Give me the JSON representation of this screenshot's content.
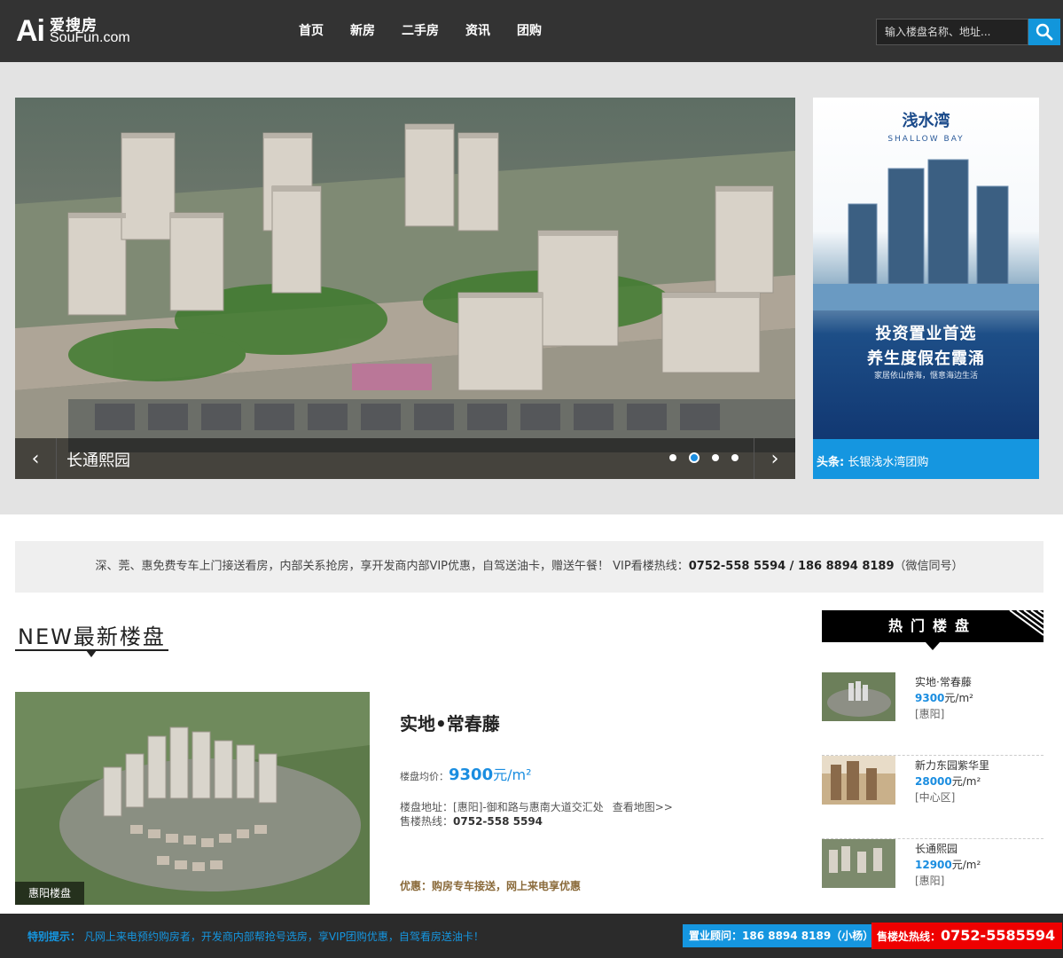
{
  "header": {
    "logo_ai": "Ai",
    "logo_cn": "爱搜房",
    "logo_en": "SouFun.com",
    "nav": [
      "首页",
      "新房",
      "二手房",
      "资讯",
      "团购"
    ],
    "search_placeholder": "输入楼盘名称、地址..."
  },
  "slider": {
    "caption": "长通熙园",
    "prev": "‹",
    "next": "›",
    "dots": 4,
    "active_dot": 2
  },
  "ad": {
    "brand": "浅水湾",
    "sub": "SHALLOW BAY",
    "slogan1": "投资置业首选",
    "slogan2": "养生度假在霞涌",
    "slogan3": "家居依山傍海，惬意海边生活",
    "headline_label": "头条:",
    "headline_text": "长银浅水湾团购"
  },
  "notice": {
    "text": "深、莞、惠免费专车上门接送看房，内部关系抢房，享开发商内部VIP优惠，自驾送油卡，赠送午餐！ VIP看楼热线：",
    "hotline": "0752-558 5594 / 186 8894 8189",
    "suffix": "（微信同号）"
  },
  "new_section": {
    "title": "NEW最新楼盘",
    "estate": {
      "tag": "惠阳楼盘",
      "name": "实地•常春藤",
      "price_label": "楼盘均价：",
      "price": "9300",
      "price_unit": "元/m²",
      "addr_label": "楼盘地址：",
      "addr": "[惠阳]-御和路与惠南大道交汇处",
      "map_link": "查看地图>>",
      "tel_label": "售楼热线：",
      "tel": "0752-558 5594",
      "promo": "优惠：购房专车接送，网上来电享优惠"
    }
  },
  "hot": {
    "title": "热门楼盘",
    "items": [
      {
        "name": "实地·常春藤",
        "price": "9300",
        "unit": "元/m²",
        "area": "[惠阳]"
      },
      {
        "name": "新力东园紫华里",
        "price": "28000",
        "unit": "元/m²",
        "area": "[中心区]"
      },
      {
        "name": "长通熙园",
        "price": "12900",
        "unit": "元/m²",
        "area": "[惠阳]"
      }
    ]
  },
  "footer": {
    "tip_label": "特别提示：",
    "tip_text": "凡网上来电预约购房者，开发商内部帮抢号选房，享VIP团购优惠，自驾看房送油卡！",
    "advisor": "置业顾问：186 8894 8189（小杨）",
    "sales_label": "售楼处热线：",
    "sales_tel": "0752-5585594"
  },
  "colors": {
    "accent": "#1596e0",
    "header_bg": "#333333",
    "sales_red": "#ee0000"
  }
}
